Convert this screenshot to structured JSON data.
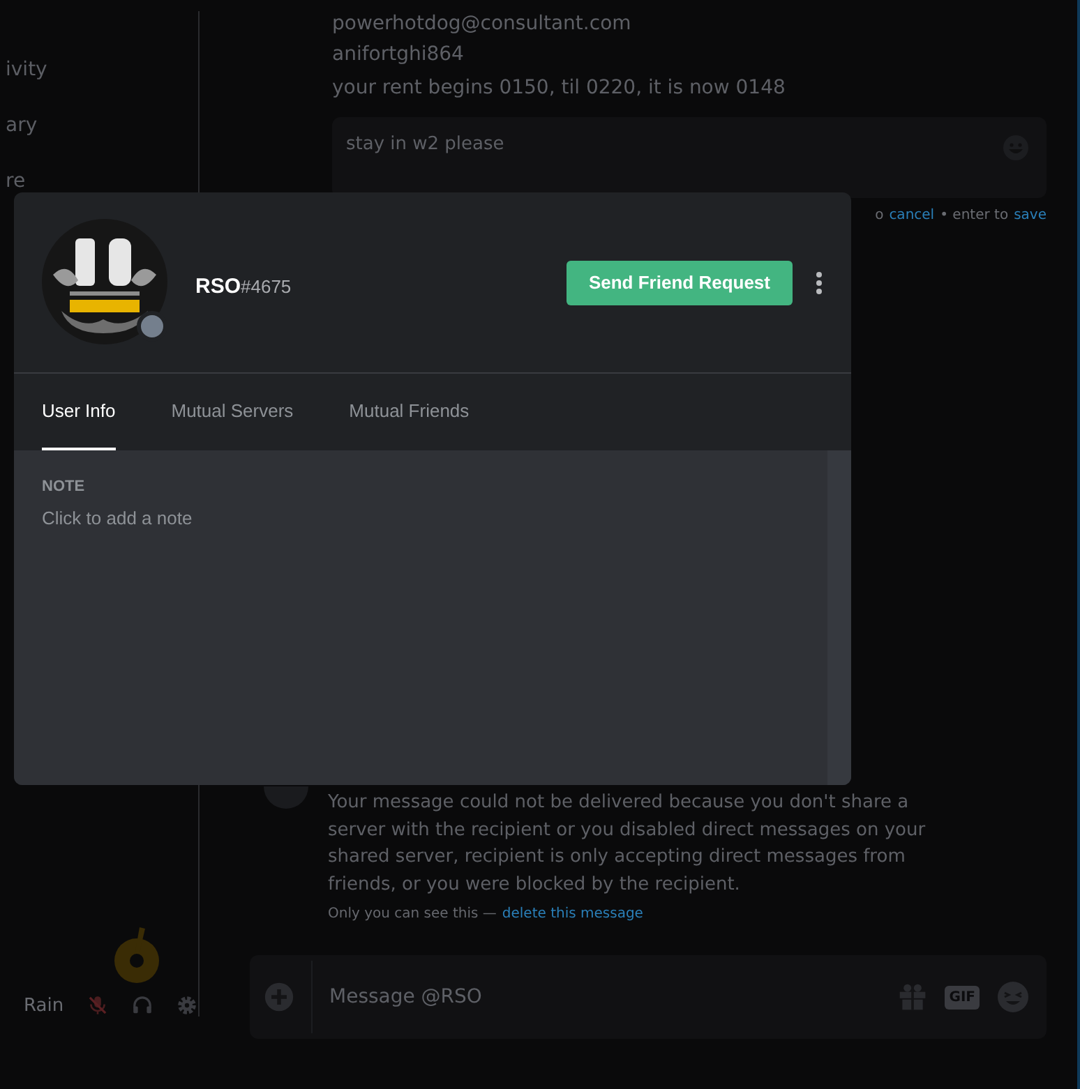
{
  "sidebar": {
    "items": [
      {
        "label": "ivity"
      },
      {
        "label": "ary"
      },
      {
        "label": "re"
      }
    ]
  },
  "messages": [
    {
      "text": "powerhotdog@consultant.com"
    },
    {
      "text": "anifortghi864"
    },
    {
      "text": "your rent begins 0150, til 0220, it is now 0148"
    }
  ],
  "edit_box": {
    "value": "stay in w2 please",
    "hint_prefix": "o",
    "hint_cancel": "cancel",
    "hint_middle": "• enter to",
    "hint_save": "save"
  },
  "system_message": {
    "text": "Your message could not be delivered because you don't share a server with the recipient or you disabled direct messages on your shared server, recipient is only accepting direct messages from friends, or you were blocked by the recipient.",
    "note": "Only you can see this —",
    "link": "delete this message"
  },
  "message_input": {
    "placeholder": "Message @RSO",
    "gif_label": "GIF"
  },
  "user_panel": {
    "name": "Rain",
    "mic_muted": true
  },
  "profile": {
    "username": "RSO",
    "tag": "#4675",
    "button": "Send Friend Request",
    "tabs": [
      {
        "label": "User Info",
        "selected": true
      },
      {
        "label": "Mutual Servers",
        "selected": false
      },
      {
        "label": "Mutual Friends",
        "selected": false
      }
    ],
    "note_label": "NOTE",
    "note_placeholder": "Click to add a note"
  }
}
